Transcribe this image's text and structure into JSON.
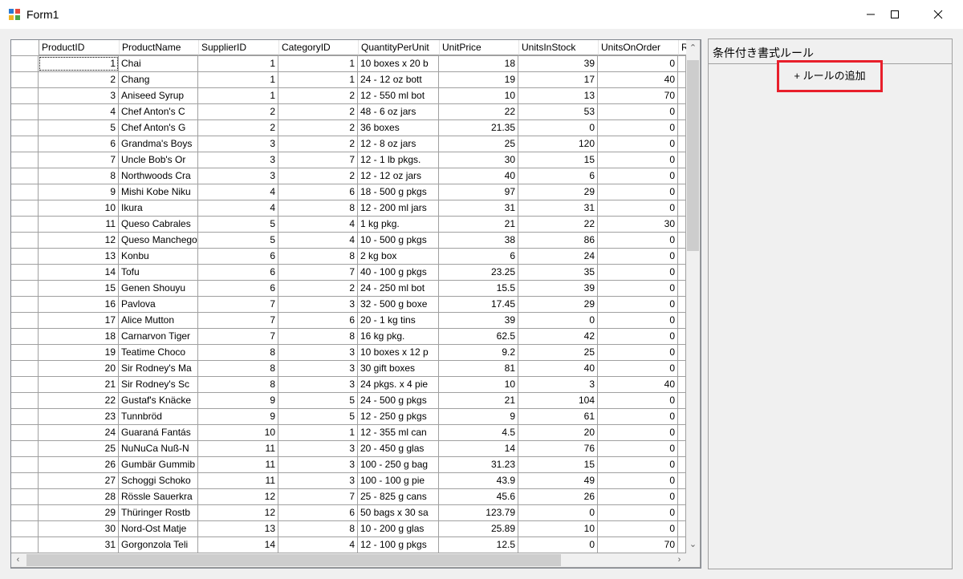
{
  "window": {
    "title": "Form1"
  },
  "columns": [
    "ProductID",
    "ProductName",
    "SupplierID",
    "CategoryID",
    "QuantityPerUnit",
    "UnitPrice",
    "UnitsInStock",
    "UnitsOnOrder",
    "R"
  ],
  "rows": [
    [
      "1",
      "Chai",
      "1",
      "1",
      "10 boxes x 20 b",
      "18",
      "39",
      "0"
    ],
    [
      "2",
      "Chang",
      "1",
      "1",
      "24 - 12 oz bott",
      "19",
      "17",
      "40"
    ],
    [
      "3",
      "Aniseed Syrup",
      "1",
      "2",
      "12 - 550 ml bot",
      "10",
      "13",
      "70"
    ],
    [
      "4",
      "Chef Anton's C",
      "2",
      "2",
      "48 - 6 oz jars",
      "22",
      "53",
      "0"
    ],
    [
      "5",
      "Chef Anton's G",
      "2",
      "2",
      "36 boxes",
      "21.35",
      "0",
      "0"
    ],
    [
      "6",
      "Grandma's Boys",
      "3",
      "2",
      "12 - 8 oz jars",
      "25",
      "120",
      "0"
    ],
    [
      "7",
      "Uncle Bob's Or",
      "3",
      "7",
      "12 - 1 lb pkgs.",
      "30",
      "15",
      "0"
    ],
    [
      "8",
      "Northwoods Cra",
      "3",
      "2",
      "12 - 12 oz jars",
      "40",
      "6",
      "0"
    ],
    [
      "9",
      "Mishi Kobe Niku",
      "4",
      "6",
      "18 - 500 g pkgs",
      "97",
      "29",
      "0"
    ],
    [
      "10",
      "Ikura",
      "4",
      "8",
      "12 - 200 ml jars",
      "31",
      "31",
      "0"
    ],
    [
      "11",
      "Queso Cabrales",
      "5",
      "4",
      "1 kg pkg.",
      "21",
      "22",
      "30"
    ],
    [
      "12",
      "Queso Manchego",
      "5",
      "4",
      "10 - 500 g pkgs",
      "38",
      "86",
      "0"
    ],
    [
      "13",
      "Konbu",
      "6",
      "8",
      "2 kg box",
      "6",
      "24",
      "0"
    ],
    [
      "14",
      "Tofu",
      "6",
      "7",
      "40 - 100 g pkgs",
      "23.25",
      "35",
      "0"
    ],
    [
      "15",
      "Genen Shouyu",
      "6",
      "2",
      "24 - 250 ml bot",
      "15.5",
      "39",
      "0"
    ],
    [
      "16",
      "Pavlova",
      "7",
      "3",
      "32 - 500 g boxe",
      "17.45",
      "29",
      "0"
    ],
    [
      "17",
      "Alice Mutton",
      "7",
      "6",
      "20 - 1 kg tins",
      "39",
      "0",
      "0"
    ],
    [
      "18",
      "Carnarvon Tiger",
      "7",
      "8",
      "16 kg pkg.",
      "62.5",
      "42",
      "0"
    ],
    [
      "19",
      "Teatime Choco",
      "8",
      "3",
      "10 boxes x 12 p",
      "9.2",
      "25",
      "0"
    ],
    [
      "20",
      "Sir Rodney's Ma",
      "8",
      "3",
      "30 gift boxes",
      "81",
      "40",
      "0"
    ],
    [
      "21",
      "Sir Rodney's Sc",
      "8",
      "3",
      "24 pkgs. x 4 pie",
      "10",
      "3",
      "40"
    ],
    [
      "22",
      "Gustaf's Knäcke",
      "9",
      "5",
      "24 - 500 g pkgs",
      "21",
      "104",
      "0"
    ],
    [
      "23",
      "Tunnbröd",
      "9",
      "5",
      "12 - 250 g pkgs",
      "9",
      "61",
      "0"
    ],
    [
      "24",
      "Guaraná Fantás",
      "10",
      "1",
      "12 - 355 ml can",
      "4.5",
      "20",
      "0"
    ],
    [
      "25",
      "NuNuCa Nuß-N",
      "11",
      "3",
      "20 - 450 g glas",
      "14",
      "76",
      "0"
    ],
    [
      "26",
      "Gumbär Gummib",
      "11",
      "3",
      "100 - 250 g bag",
      "31.23",
      "15",
      "0"
    ],
    [
      "27",
      "Schoggi Schoko",
      "11",
      "3",
      "100 - 100 g pie",
      "43.9",
      "49",
      "0"
    ],
    [
      "28",
      "Rössle Sauerkra",
      "12",
      "7",
      "25 - 825 g cans",
      "45.6",
      "26",
      "0"
    ],
    [
      "29",
      "Thüringer Rostb",
      "12",
      "6",
      "50 bags x 30 sa",
      "123.79",
      "0",
      "0"
    ],
    [
      "30",
      "Nord-Ost Matje",
      "13",
      "8",
      "10 - 200 g glas",
      "25.89",
      "10",
      "0"
    ],
    [
      "31",
      "Gorgonzola Teli",
      "14",
      "4",
      "12 - 100 g pkgs",
      "12.5",
      "0",
      "70"
    ]
  ],
  "panel": {
    "title": "条件付き書式ルール",
    "add_button": "+ ルールの追加"
  },
  "colors": {
    "highlight_border": "#e81f2b",
    "scroll_thumb": "#cdcdcd"
  }
}
